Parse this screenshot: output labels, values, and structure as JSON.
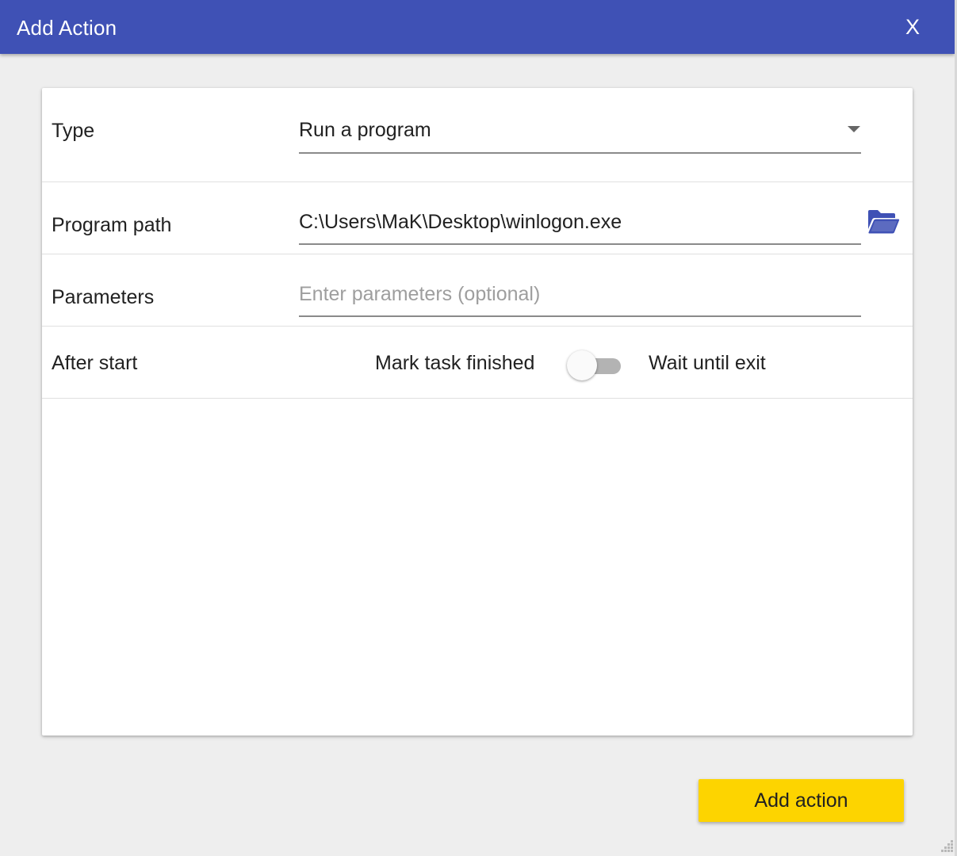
{
  "window": {
    "title": "Add Action",
    "close_label": "X"
  },
  "form": {
    "type": {
      "label": "Type",
      "value": "Run a program"
    },
    "program_path": {
      "label": "Program path",
      "value": "C:\\Users\\MaK\\Desktop\\winlogon.exe"
    },
    "parameters": {
      "label": "Parameters",
      "value": "",
      "placeholder": "Enter parameters (optional)"
    },
    "after_start": {
      "label": "After start",
      "option_off": "Mark task finished",
      "option_on": "Wait until exit",
      "toggle_on": false
    }
  },
  "footer": {
    "add_label": "Add action"
  },
  "colors": {
    "titlebar": "#3f51b5",
    "accent_button": "#fdd400",
    "folder_icon": "#3f51b5"
  }
}
